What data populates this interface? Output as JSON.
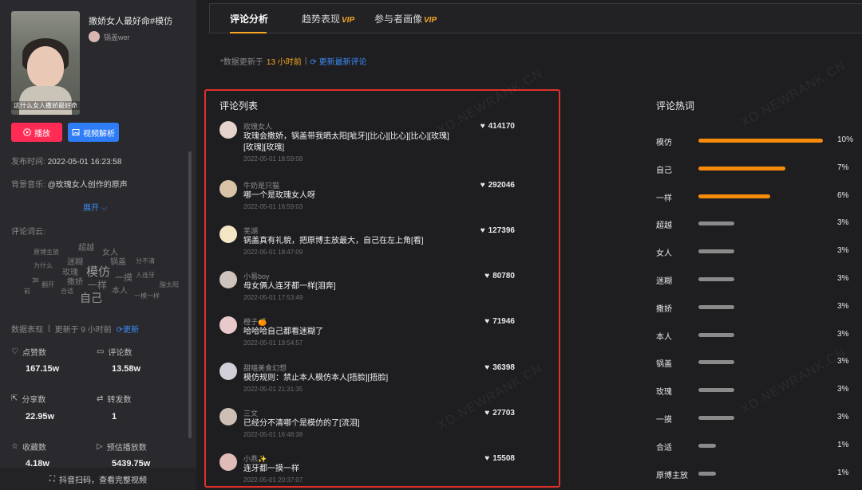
{
  "video": {
    "title": "撒娇女人最好命#模仿",
    "author": "锅盖wer",
    "thumb_caption": "这什么女人撒娇最好命"
  },
  "buttons": {
    "play": "播放",
    "analyze": "视频解析"
  },
  "meta": {
    "publish_label": "发布时间:",
    "publish_value": "2022-05-01 16:23:58",
    "music_label": "背景音乐:",
    "music_value": "@玫瑰女人创作的原声",
    "expand": "展开",
    "cloud_label": "评论词云:"
  },
  "word_cloud": [
    "超越",
    "女人",
    "原博主放",
    "锅盖",
    "模仿",
    "为什么",
    "迷糊",
    "分不清",
    "玫瑰",
    "一摸",
    "人连牙",
    "撒娇",
    "一样",
    "本人",
    "酯太阳",
    "自己",
    "合适",
    "一模一样",
    "翻开",
    "真",
    "前"
  ],
  "data_section": {
    "label": "数据表现",
    "updated": "更新于 9 小时前",
    "refresh": "更新"
  },
  "stats": {
    "likes_label": "点赞数",
    "likes_value": "167.15w",
    "comments_label": "评论数",
    "comments_value": "13.58w",
    "shares_label": "分享数",
    "shares_value": "22.95w",
    "forwards_label": "转发数",
    "forwards_value": "1",
    "favorites_label": "收藏数",
    "favorites_value": "4.18w",
    "plays_label": "预估播放数",
    "plays_value": "5439.75w"
  },
  "footer": "抖音扫码，查看完整视频",
  "tabs": [
    {
      "label": "评论分析",
      "vip": ""
    },
    {
      "label": "趋势表现",
      "vip": "VIP"
    },
    {
      "label": "参与者画像",
      "vip": "VIP"
    }
  ],
  "update_bar": {
    "prefix": "*数据更新于",
    "time": "13 小时前",
    "sep": "|",
    "link": "更新最新评论"
  },
  "comments_title": "评论列表",
  "comments": [
    {
      "name": "玫瑰女人",
      "text": "玫瑰会撒娇，锅盖带我晒太阳[呲牙][比心][比心][比心][玫瑰][玫瑰][玫瑰]",
      "time": "2022-05-01 18:59:08",
      "likes": "414170"
    },
    {
      "name": "牛奶是只猫",
      "text": "哪一个是玫瑰女人呀",
      "time": "2022-05-01 16:59:03",
      "likes": "292046"
    },
    {
      "name": "芜湖",
      "text": "锅盖真有礼貌，把原博主放最大，自己在左上角[看]",
      "time": "2022-05-01 18:47:09",
      "likes": "127396"
    },
    {
      "name": "小易boy",
      "text": "母女俩人连牙都一样[泪奔]",
      "time": "2022-05-01 17:53:49",
      "likes": "80780"
    },
    {
      "name": "橙子🍊",
      "text": "哈哈哈自己都看迷糊了",
      "time": "2022-05-01 19:54:57",
      "likes": "71946"
    },
    {
      "name": "甜喵美食幻想",
      "text": "模仿规则：禁止本人模仿本人[捂脸][捂脸]",
      "time": "2022-05-01 21:31:35",
      "likes": "36398"
    },
    {
      "name": "三文",
      "text": "已经分不清哪个是模仿的了[流泪]",
      "time": "2022-05-01 16:48:38",
      "likes": "27703"
    },
    {
      "name": "小燕✨",
      "text": "连牙都一摸一样",
      "time": "2022-05-01 20:37:07",
      "likes": "15508"
    }
  ],
  "heat_title": "评论热词",
  "heat_words": [
    {
      "word": "模仿",
      "pct": "10%",
      "fraction": 1.0,
      "color": "#f58a0b"
    },
    {
      "word": "自己",
      "pct": "7%",
      "fraction": 0.7,
      "color": "#f58a0b"
    },
    {
      "word": "一样",
      "pct": "6%",
      "fraction": 0.58,
      "color": "#f58a0b"
    },
    {
      "word": "超越",
      "pct": "3%",
      "fraction": 0.29,
      "color": "#8a8a8a"
    },
    {
      "word": "女人",
      "pct": "3%",
      "fraction": 0.29,
      "color": "#8a8a8a"
    },
    {
      "word": "迷糊",
      "pct": "3%",
      "fraction": 0.29,
      "color": "#8a8a8a"
    },
    {
      "word": "撒娇",
      "pct": "3%",
      "fraction": 0.29,
      "color": "#8a8a8a"
    },
    {
      "word": "本人",
      "pct": "3%",
      "fraction": 0.29,
      "color": "#8a8a8a"
    },
    {
      "word": "锅盖",
      "pct": "3%",
      "fraction": 0.29,
      "color": "#8a8a8a"
    },
    {
      "word": "玫瑰",
      "pct": "3%",
      "fraction": 0.29,
      "color": "#8a8a8a"
    },
    {
      "word": "一摸",
      "pct": "3%",
      "fraction": 0.29,
      "color": "#8a8a8a"
    },
    {
      "word": "合适",
      "pct": "1%",
      "fraction": 0.14,
      "color": "#8a8a8a"
    },
    {
      "word": "原博主放",
      "pct": "1%",
      "fraction": 0.14,
      "color": "#8a8a8a"
    }
  ],
  "watermark": "XD.NEWRANK.CN",
  "colors": {
    "accent": "#f6a623",
    "play": "#fe2c55",
    "link": "#3d8bf6",
    "highlight_border": "#e0302a"
  }
}
